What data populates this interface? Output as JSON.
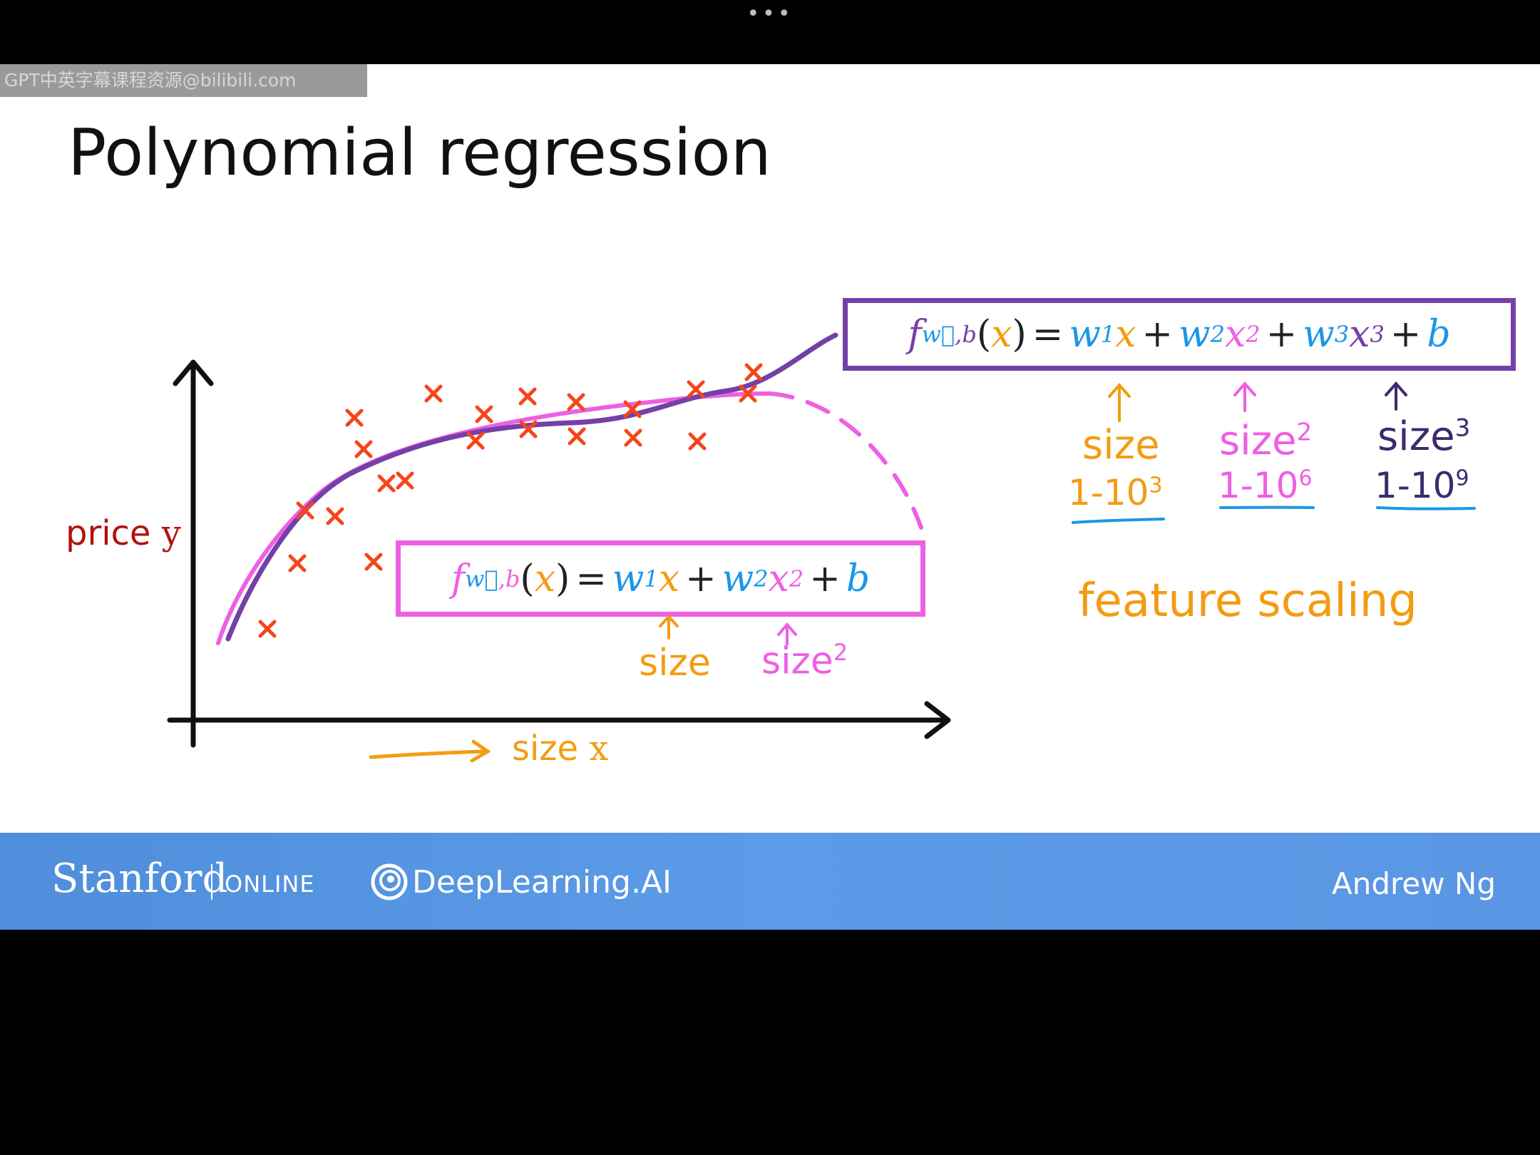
{
  "player": {
    "more_icon": "more-horizontal-icon",
    "more_glyph": "•••"
  },
  "watermark": "GPT中英字幕课程资源@bilibili.com",
  "slide": {
    "title": "Polynomial regression",
    "axis_labels": {
      "y_word": "price",
      "y_var": "y",
      "x_word": "size",
      "x_var": "x"
    },
    "formula_cubic": {
      "f": "f",
      "sub_w": "w⃗",
      "sub_b": ",b",
      "x": "x",
      "w1": "w",
      "w1_sub": "1",
      "w2": "w",
      "w2_sub": "2",
      "sq": "2",
      "w3": "w",
      "w3_sub": "3",
      "cube": "3",
      "b": "b",
      "eq": "=",
      "plus": "+"
    },
    "formula_quadratic": {
      "f": "f",
      "sub_w": "w⃗",
      "sub_b": ",b",
      "x": "x",
      "w1": "w",
      "w1_sub": "1",
      "w2": "w",
      "w2_sub": "2",
      "sq": "2",
      "b": "b",
      "eq": "=",
      "plus": "+"
    },
    "annotations": {
      "size": "size",
      "size2_base": "size",
      "size2_exp": "2",
      "size3_base": "size",
      "size3_exp": "3",
      "range1_base": "1-10",
      "range1_exp": "3",
      "range2_base": "1-10",
      "range2_exp": "6",
      "range3_base": "1-10",
      "range3_exp": "9",
      "quad_size": "size",
      "quad_size2_base": "size",
      "quad_size2_exp": "2",
      "feature_scaling": "feature scaling"
    },
    "colors": {
      "purple": "#7440a8",
      "pink": "#ee5fe4",
      "blue": "#1a97e8",
      "orange": "#f39c12",
      "data_points": "#f5451c",
      "axis_label_red": "#b0120e"
    }
  },
  "footer": {
    "stanford": "Stanford",
    "online": "ONLINE",
    "deeplearning": "DeepLearning.AI",
    "author": "Andrew Ng"
  }
}
